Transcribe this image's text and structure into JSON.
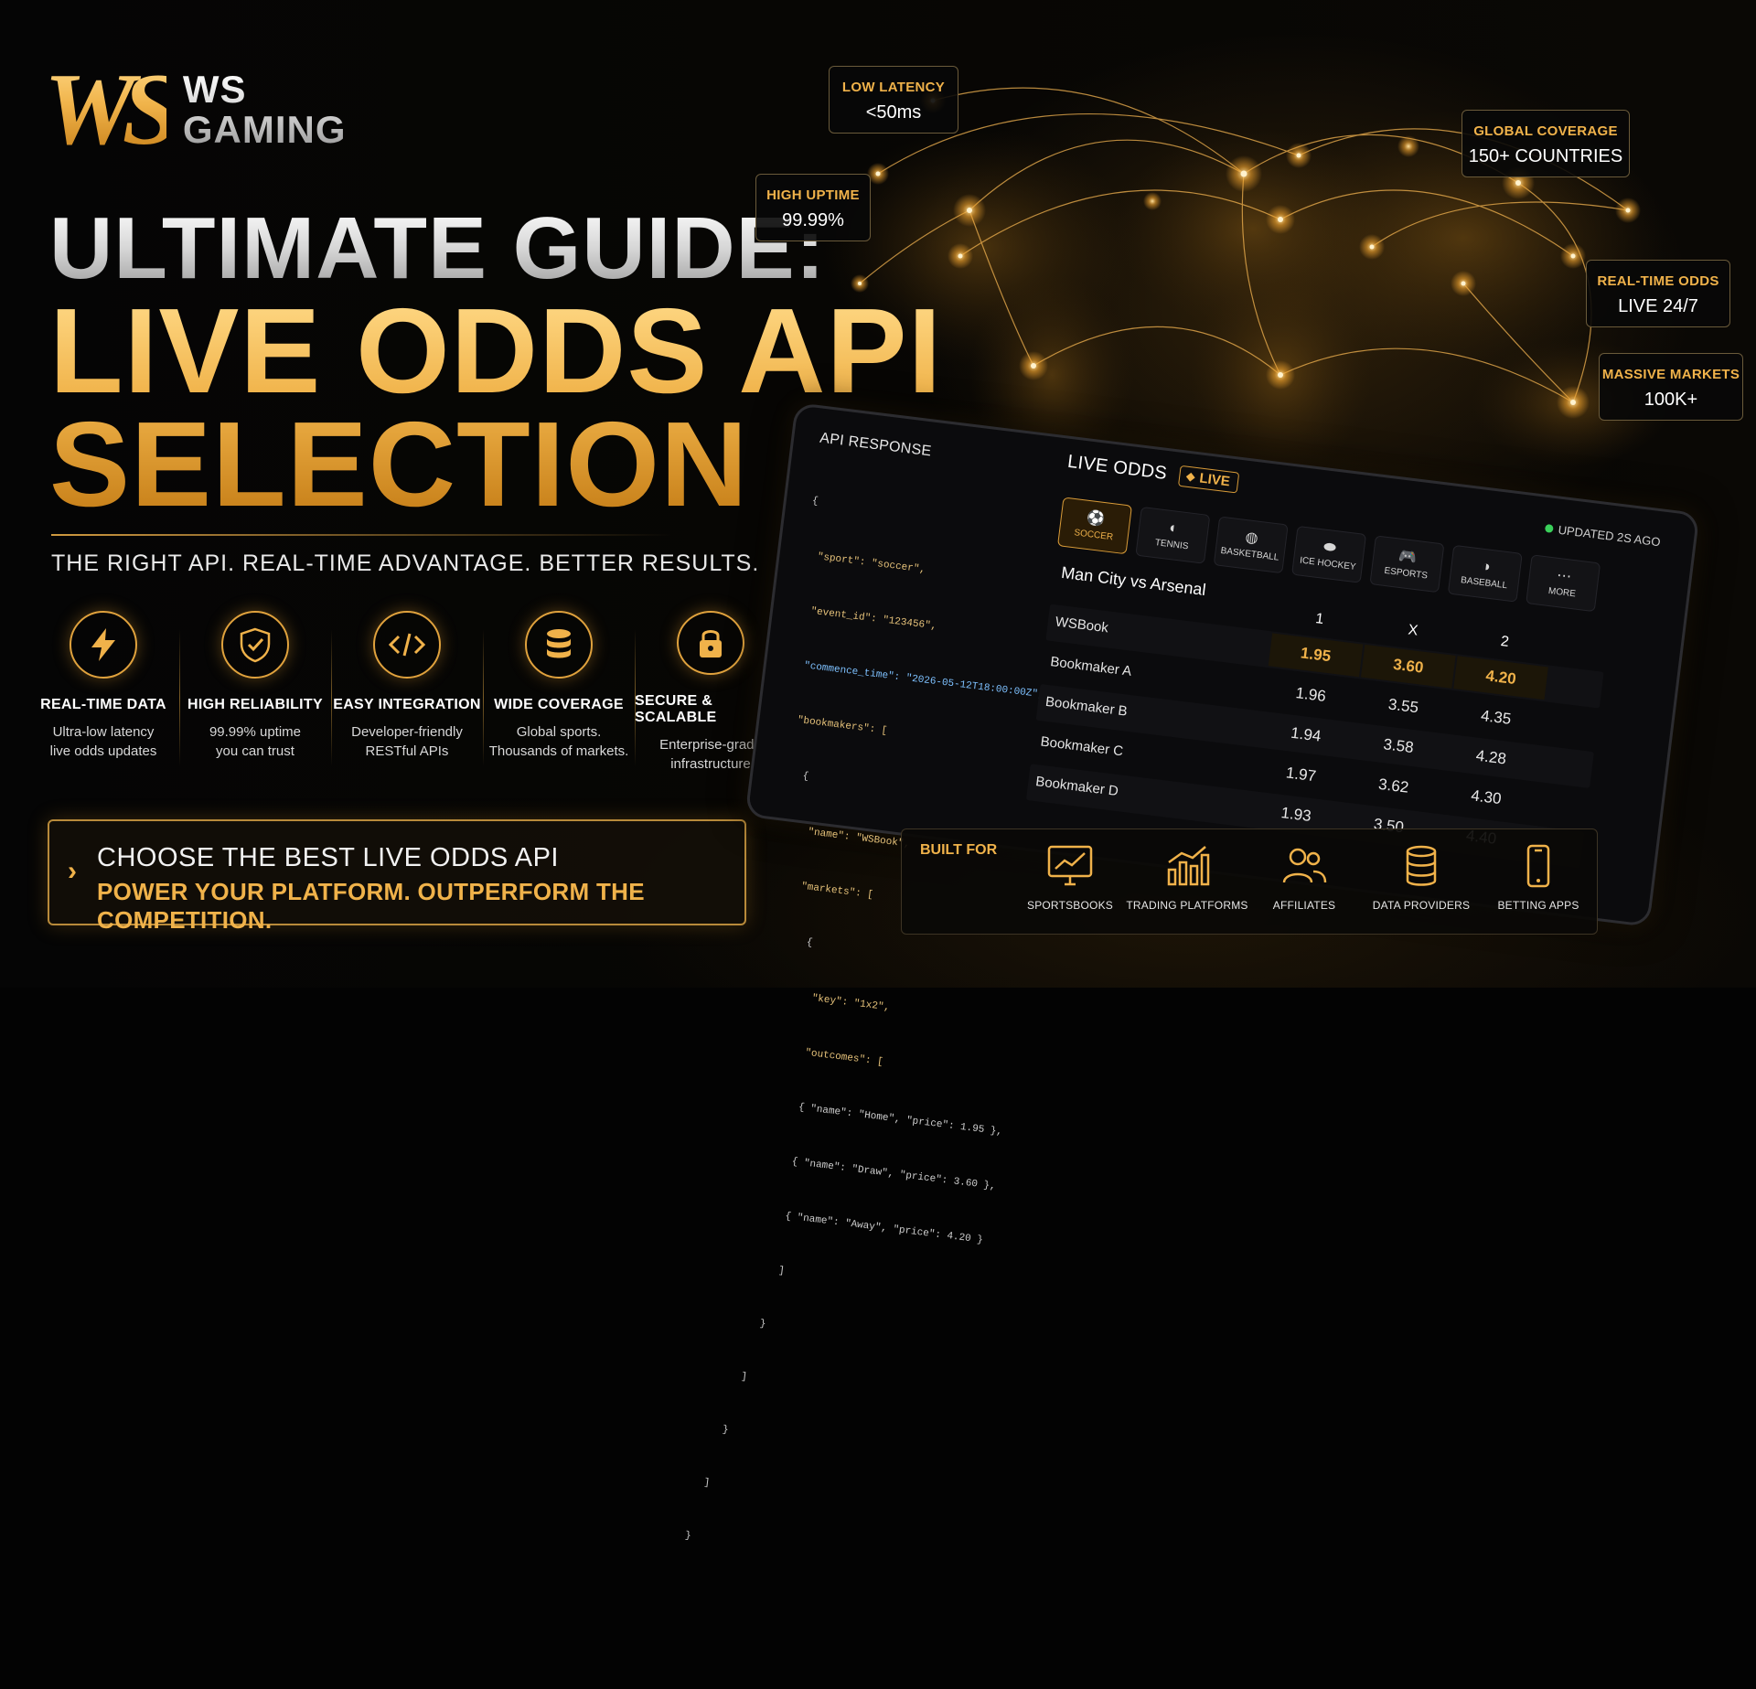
{
  "brand": {
    "mark": "WS",
    "line1": "WS",
    "line2": "GAMING"
  },
  "headline": {
    "line1": "ULTIMATE GUIDE:",
    "line2": "LIVE ODDS API",
    "line3": "SELECTION"
  },
  "tagline": "THE RIGHT API. REAL-TIME ADVANTAGE. BETTER RESULTS.",
  "features": [
    {
      "icon": "lightning-icon",
      "title": "REAL-TIME DATA",
      "desc1": "Ultra-low latency",
      "desc2": "live odds updates"
    },
    {
      "icon": "shield-check-icon",
      "title": "HIGH RELIABILITY",
      "desc1": "99.99% uptime",
      "desc2": "you can trust"
    },
    {
      "icon": "code-icon",
      "title": "EASY INTEGRATION",
      "desc1": "Developer-friendly",
      "desc2": "RESTful APIs"
    },
    {
      "icon": "database-icon",
      "title": "WIDE COVERAGE",
      "desc1": "Global sports.",
      "desc2": "Thousands of markets."
    },
    {
      "icon": "lock-icon",
      "title": "SECURE & SCALABLE",
      "desc1": "Enterprise-grade",
      "desc2": "infrastructure"
    }
  ],
  "cta": {
    "line1": "CHOOSE THE BEST LIVE ODDS API",
    "line2": "POWER YOUR PLATFORM. OUTPERFORM THE COMPETITION."
  },
  "stats": {
    "latency": {
      "label": "LOW LATENCY",
      "value": "<50ms"
    },
    "uptime": {
      "label": "HIGH UPTIME",
      "value": "99.99%"
    },
    "coverage": {
      "label": "GLOBAL COVERAGE",
      "value": "150+ COUNTRIES"
    },
    "realtime": {
      "label": "REAL-TIME ODDS",
      "value": "LIVE 24/7"
    },
    "markets": {
      "label": "MASSIVE MARKETS",
      "value": "100K+"
    }
  },
  "api": {
    "title": "API RESPONSE",
    "lines": [
      "{",
      "  \"sport\": \"soccer\",",
      "  \"event_id\": \"123456\",",
      "  \"commence_time\": \"2026-05-12T18:00:00Z\",",
      "  \"bookmakers\": [",
      "    {",
      "      \"name\": \"WSBook\",",
      "      \"markets\": [",
      "        {",
      "          \"key\": \"1x2\",",
      "          \"outcomes\": [",
      "          { \"name\": \"Home\", \"price\": 1.95 },",
      "          { \"name\": \"Draw\", \"price\": 3.60 },",
      "          { \"name\": \"Away\", \"price\": 4.20 }",
      "          ]",
      "        }",
      "      ]",
      "    }",
      "  ]",
      "}"
    ]
  },
  "odds": {
    "title": "LIVE ODDS",
    "live": "LIVE",
    "updated": "UPDATED 2S AGO",
    "sports": [
      {
        "label": "SOCCER",
        "icon": "soccer-ball-icon",
        "glyph": "⚽"
      },
      {
        "label": "TENNIS",
        "icon": "tennis-ball-icon",
        "glyph": "◐"
      },
      {
        "label": "BASKETBALL",
        "icon": "basketball-icon",
        "glyph": "◍"
      },
      {
        "label": "ICE HOCKEY",
        "icon": "hockey-puck-icon",
        "glyph": "⬬"
      },
      {
        "label": "ESPORTS",
        "icon": "gamepad-icon",
        "glyph": "🎮"
      },
      {
        "label": "BASEBALL",
        "icon": "baseball-icon",
        "glyph": "◑"
      },
      {
        "label": "MORE",
        "icon": "more-icon",
        "glyph": "⋯"
      }
    ],
    "match": "Man City vs Arsenal",
    "columns": [
      "1",
      "X",
      "2"
    ],
    "rows": [
      {
        "name": "WSBook",
        "v1": "1.95",
        "vx": "3.60",
        "v2": "4.20"
      },
      {
        "name": "Bookmaker A",
        "v1": "1.96",
        "vx": "3.55",
        "v2": "4.35"
      },
      {
        "name": "Bookmaker B",
        "v1": "1.94",
        "vx": "3.58",
        "v2": "4.28"
      },
      {
        "name": "Bookmaker C",
        "v1": "1.97",
        "vx": "3.62",
        "v2": "4.30"
      },
      {
        "name": "Bookmaker D",
        "v1": "1.93",
        "vx": "3.50",
        "v2": "4.40"
      }
    ]
  },
  "built_for": {
    "title": "BUILT FOR",
    "items": [
      {
        "label": "SPORTSBOOKS",
        "icon": "monitor-chart-icon"
      },
      {
        "label": "TRADING PLATFORMS",
        "icon": "bar-chart-icon"
      },
      {
        "label": "AFFILIATES",
        "icon": "users-icon"
      },
      {
        "label": "DATA PROVIDERS",
        "icon": "database-icon"
      },
      {
        "label": "BETTING APPS",
        "icon": "smartphone-icon"
      }
    ]
  },
  "colors": {
    "gold": "#f0b24a",
    "dark": "#030303",
    "green": "#3ad05a"
  }
}
